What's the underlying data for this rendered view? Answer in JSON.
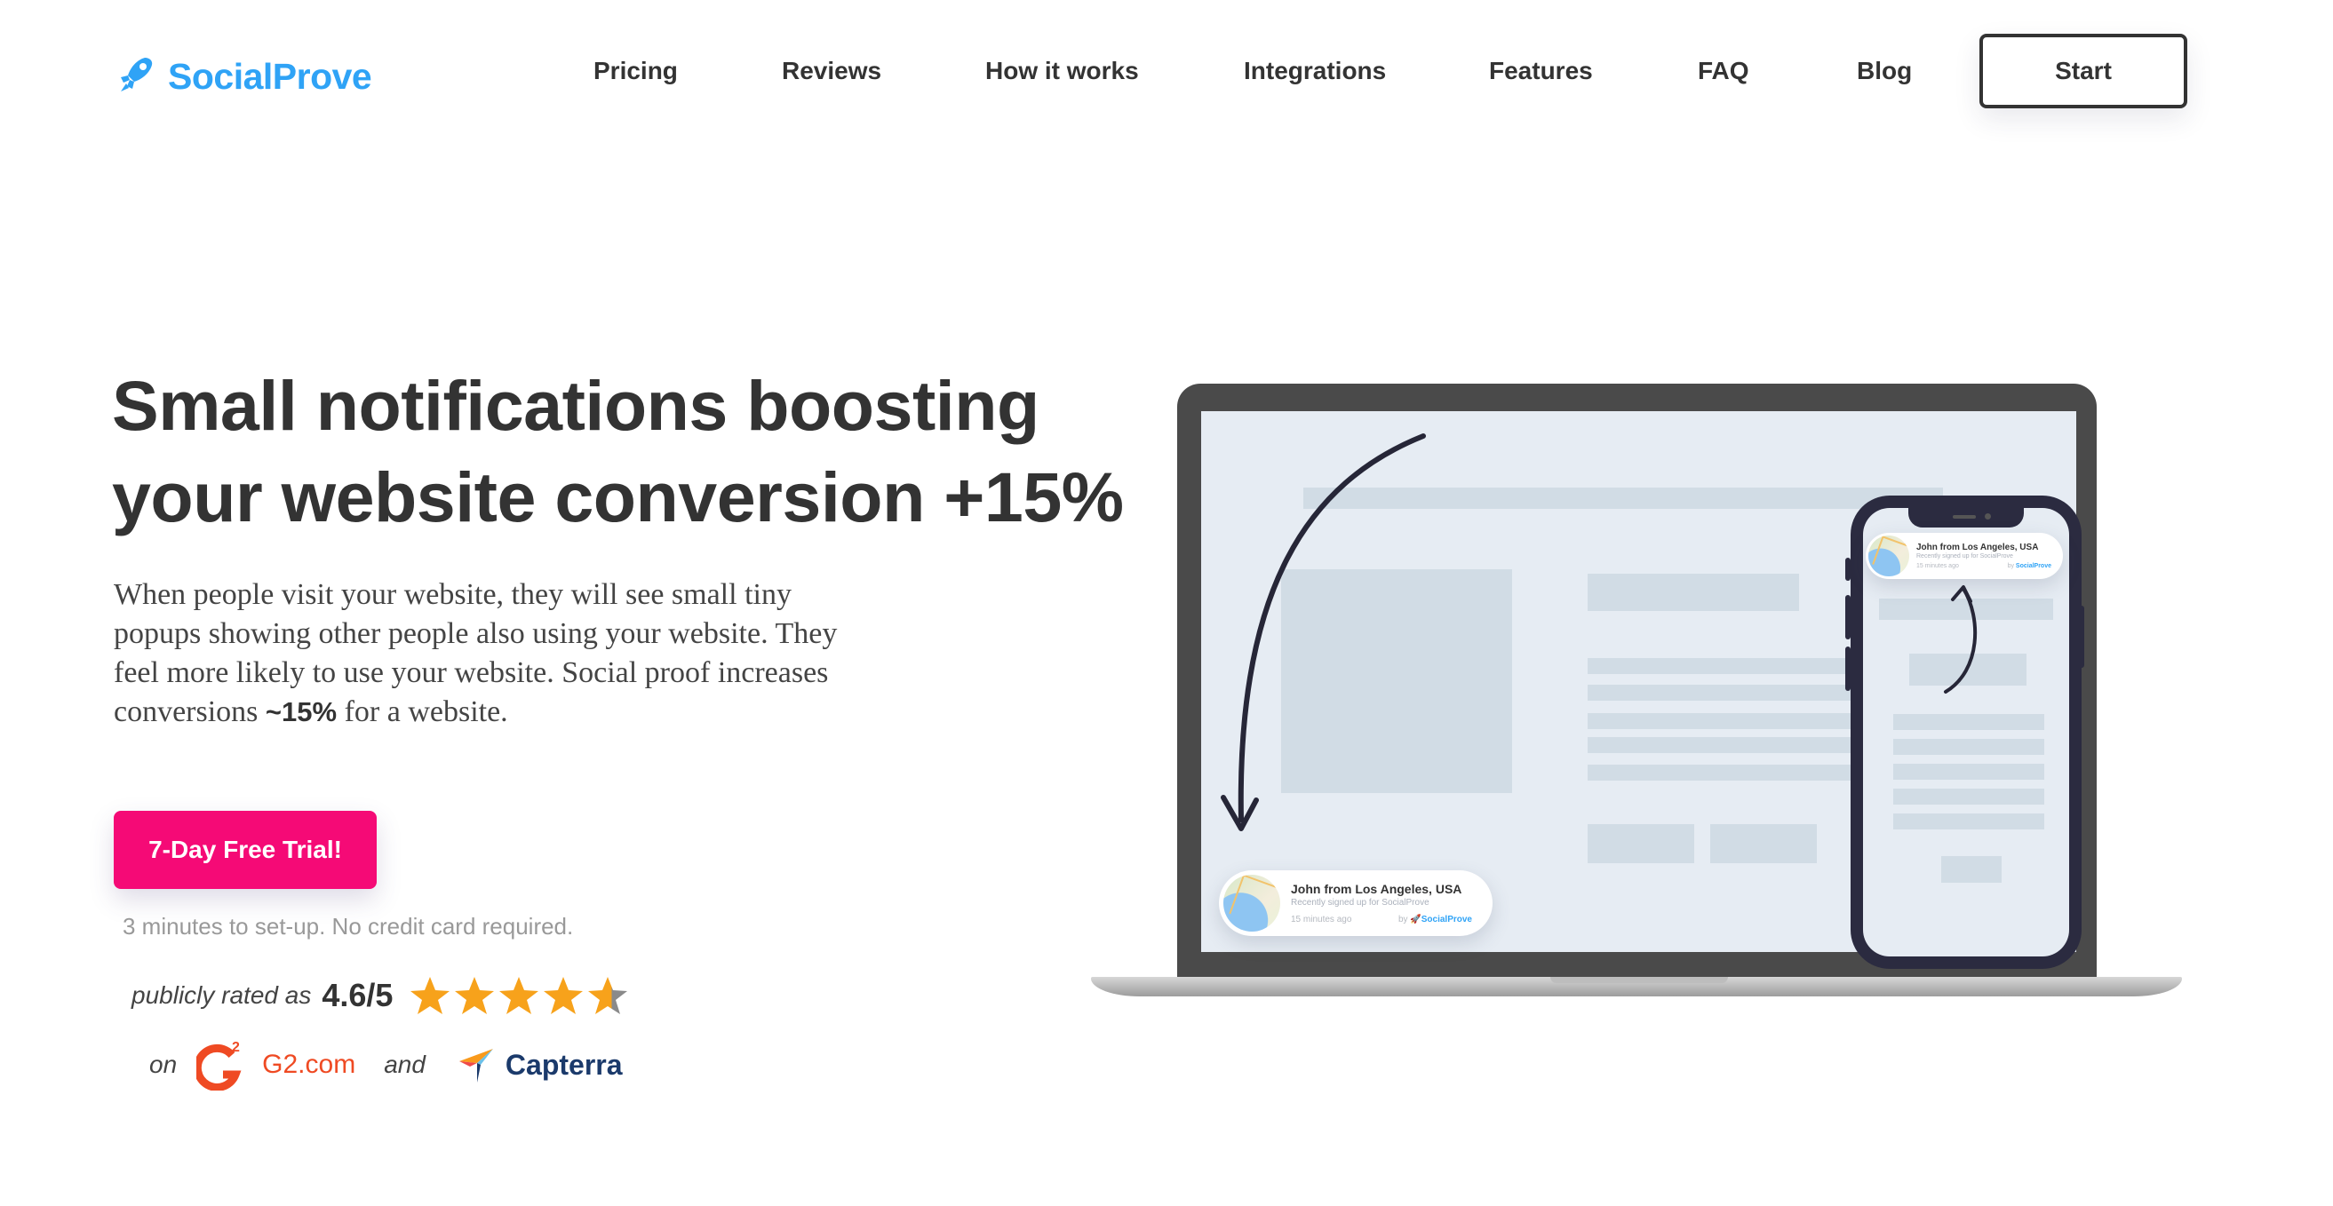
{
  "header": {
    "logo_text": "SocialProve",
    "logo_icon": "rocket-icon",
    "nav": [
      {
        "label": "Pricing"
      },
      {
        "label": "Reviews"
      },
      {
        "label": "How it works"
      },
      {
        "label": "Integrations"
      },
      {
        "label": "Features"
      },
      {
        "label": "FAQ"
      },
      {
        "label": "Blog"
      }
    ],
    "start_label": "Start"
  },
  "hero": {
    "headline_line1": "Small notifications boosting",
    "headline_line2": "your website conversion +15%",
    "paragraph_before": "When people visit your website, they will see small tiny popups showing other people also using your website. They feel more likely to use your website. Social proof increases conversions ",
    "paragraph_bold": "~15%",
    "paragraph_after": " for a website.",
    "cta_label": "7-Day Free Trial!",
    "subnote": "3 minutes to set-up. No credit card required.",
    "rating": {
      "label": "publicly rated as",
      "value": "4.6/5",
      "score": 4.6,
      "max": 5,
      "on_label": "on",
      "and_label": "and",
      "platform1": "G2.com",
      "platform2": "Capterra"
    }
  },
  "illustration": {
    "notification": {
      "title": "John from Los Angeles, USA",
      "subtitle": "Recently signed up for SocialProve",
      "time": "15 minutes ago",
      "by_label": "by",
      "brand": "SocialProve"
    }
  },
  "colors": {
    "brand_blue": "#2fa3f6",
    "cta_pink": "#f50a76",
    "text_dark": "#333333",
    "star_orange": "#f7a21b",
    "g2_red": "#ef4a23",
    "capterra_navy": "#1b3a6b"
  }
}
